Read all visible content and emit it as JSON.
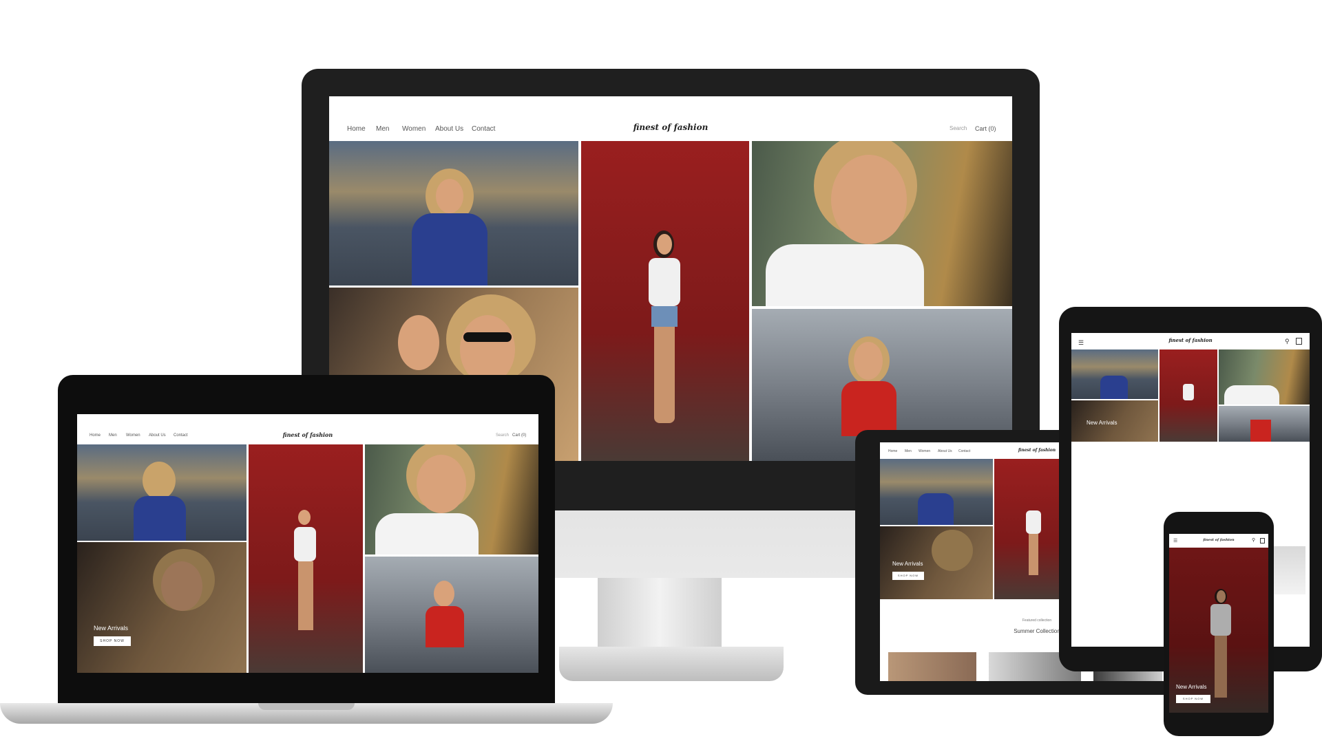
{
  "site": {
    "logo": "finest of fashion",
    "nav": [
      "Home",
      "Men",
      "Women",
      "About Us",
      "Contact"
    ],
    "search": "Search",
    "cart": "Cart (0)"
  },
  "hero": {
    "title": "New Arrivals",
    "button": "SHOP NOW"
  },
  "featured": {
    "kicker": "Featured collection",
    "title": "Summer Collection"
  },
  "colors": {
    "bezel": "#1f1f1f",
    "brick": "#8a1e1e",
    "silver": "#d9d9d9"
  },
  "icons": [
    "menu-icon",
    "search-icon",
    "bag-icon"
  ]
}
